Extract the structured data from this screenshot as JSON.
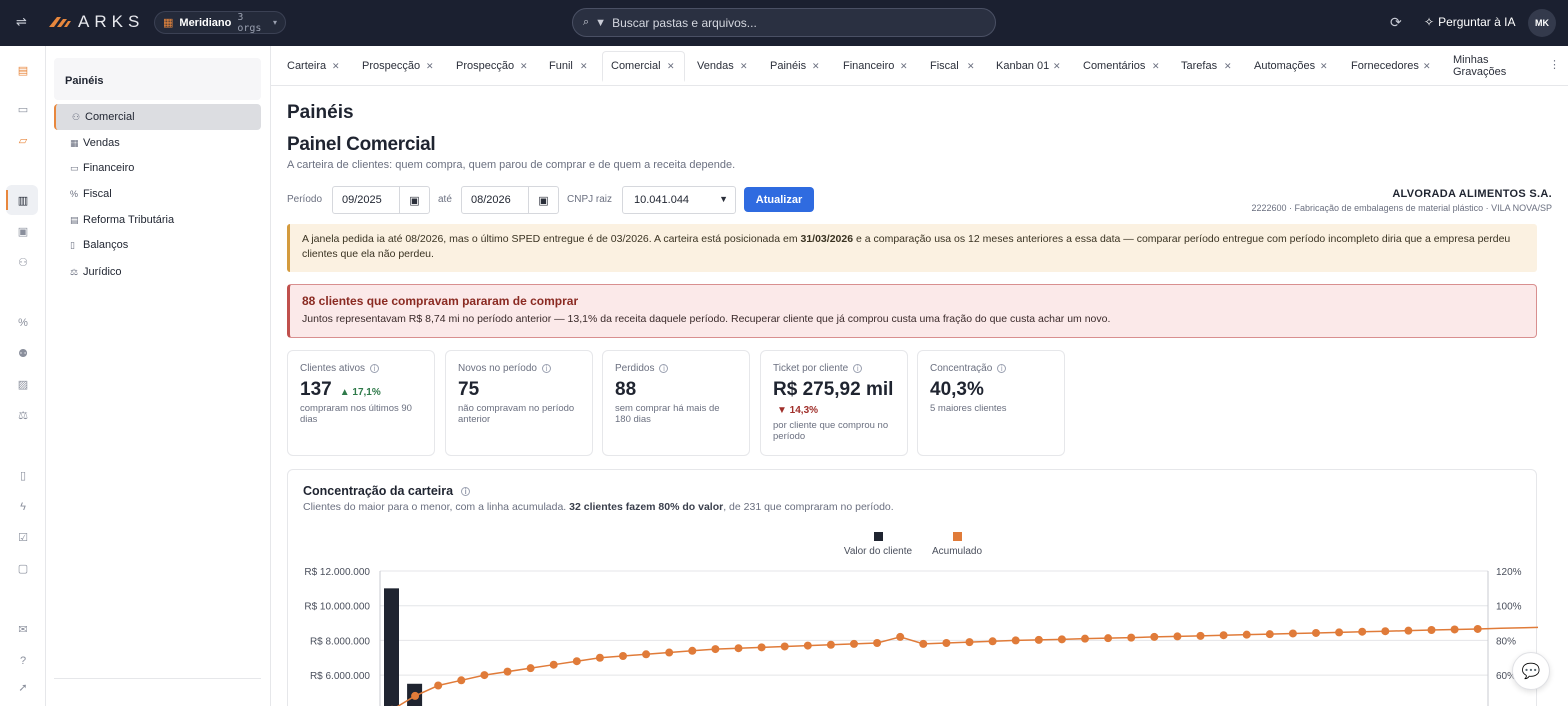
{
  "app": {
    "brand": "ARKS",
    "org_name": "Meridiano",
    "org_count": "3 orgs",
    "search_placeholder": "Buscar pastas e arquivos...",
    "ask_ai": "Perguntar à IA",
    "avatar": "MK"
  },
  "rail": {
    "icons": [
      "building-icon",
      "document-icon",
      "folder-icon",
      "bar-chart-icon",
      "card-icon",
      "users-icon",
      "percent-icon",
      "people-icon",
      "image-icon",
      "scale-icon",
      "book-icon",
      "bolt-icon",
      "check-icon",
      "chat-icon",
      "mail-icon",
      "help-icon",
      "rocket-icon"
    ],
    "active": "bar-chart-icon"
  },
  "sidepanel": {
    "title": "Painéis",
    "items": [
      {
        "label": "Comercial",
        "icon": "users-icon",
        "active": true
      },
      {
        "label": "Vendas",
        "icon": "grid-icon"
      },
      {
        "label": "Financeiro",
        "icon": "card-icon"
      },
      {
        "label": "Fiscal",
        "icon": "percent-icon"
      },
      {
        "label": "Reforma Tributária",
        "icon": "table-icon"
      },
      {
        "label": "Balanços",
        "icon": "file-icon"
      },
      {
        "label": "Jurídico",
        "icon": "scale-icon"
      }
    ]
  },
  "tabs": [
    {
      "label": "Carteira"
    },
    {
      "label": "Prospecção"
    },
    {
      "label": "Prospecção"
    },
    {
      "label": "Funil"
    },
    {
      "label": "Comercial",
      "active": true
    },
    {
      "label": "Vendas"
    },
    {
      "label": "Painéis"
    },
    {
      "label": "Financeiro"
    },
    {
      "label": "Fiscal"
    },
    {
      "label": "Kanban 01"
    },
    {
      "label": "Comentários"
    },
    {
      "label": "Tarefas"
    },
    {
      "label": "Automações"
    },
    {
      "label": "Fornecedores"
    },
    {
      "label": "Minhas Gravações"
    }
  ],
  "page": {
    "title": "Painéis",
    "panel_title": "Painel Comercial",
    "panel_subtitle": "A carteira de clientes: quem compra, quem parou de comprar e de quem a receita depende."
  },
  "filters": {
    "period_label": "Período",
    "from": "09/2025",
    "until_label": "até",
    "to": "08/2026",
    "cnpj_label": "CNPJ raiz",
    "cnpj_value": "10.041.044",
    "update_button": "Atualizar"
  },
  "company": {
    "name": "ALVORADA ALIMENTOS S.A.",
    "desc": "2222600 · Fabricação de embalagens de material plástico · VILA NOVA/SP"
  },
  "warning": {
    "text_before": "A janela pedida ia até 08/2026, mas o último SPED entregue é de 03/2026. A carteira está posicionada em ",
    "date_bold": "31/03/2026",
    "text_after": " e a comparação usa os 12 meses anteriores a essa data — comparar período entregue com período incompleto diria que a empresa perdeu clientes que ela não perdeu."
  },
  "danger": {
    "headline": "88 clientes que compravam pararam de comprar",
    "detail": "Juntos representavam R$ 8,74 mi no período anterior — 13,1% da receita daquele período. Recuperar cliente que já comprou custa uma fração do que custa achar um novo."
  },
  "kpis": [
    {
      "label": "Clientes ativos",
      "value": "137",
      "delta": "▲ 17,1%",
      "delta_dir": "up",
      "caption": "compraram nos últimos 90 dias"
    },
    {
      "label": "Novos no período",
      "value": "75",
      "delta": "",
      "caption": "não compravam no período anterior"
    },
    {
      "label": "Perdidos",
      "value": "88",
      "delta": "",
      "caption": "sem comprar há mais de 180 dias"
    },
    {
      "label": "Ticket por cliente",
      "value": "R$ 275,92 mil",
      "delta": "▼ 14,3%",
      "delta_dir": "down",
      "caption": "por cliente que comprou no período"
    },
    {
      "label": "Concentração",
      "value": "40,3%",
      "delta": "",
      "caption": "5 maiores clientes"
    }
  ],
  "chart_card": {
    "title": "Concentração da carteira",
    "sub_before": "Clientes do maior para o menor, com a linha acumulada. ",
    "sub_bold": "32 clientes fazem 80% do valor",
    "sub_after": ", de 231 que compraram no período."
  },
  "chart_data": {
    "type": "bar",
    "title": "",
    "legend": [
      "Valor do cliente",
      "Acumulado"
    ],
    "legend_position": "top-center",
    "colors": {
      "bars": "#1f2430",
      "line": "#e07b39"
    },
    "y_left_ticks": [
      "R$ 12.000.000",
      "R$ 10.000.000",
      "R$ 8.000.000",
      "R$ 6.000.000"
    ],
    "y_right_ticks": [
      "120%",
      "100%",
      "80%",
      "60%"
    ],
    "y_left_range": [
      4000000,
      12000000
    ],
    "y_right_range": [
      40,
      120
    ],
    "series": [
      {
        "name": "Valor do cliente",
        "type": "bar",
        "values": [
          11000000,
          5500000
        ]
      },
      {
        "name": "Acumulado",
        "type": "line",
        "values": [
          40,
          48,
          54,
          57,
          60,
          62,
          64,
          66,
          68,
          70,
          71,
          72,
          73,
          74,
          75,
          75.5,
          76,
          76.5,
          77,
          77.5,
          78,
          78.5,
          82,
          78,
          78.5,
          79,
          79.5,
          80,
          80.3,
          80.6,
          81,
          81.3,
          81.6,
          82,
          82.3,
          82.6,
          83,
          83.3,
          83.6,
          84,
          84.3,
          84.6,
          85,
          85.3,
          85.6,
          86,
          86.3,
          86.6,
          87,
          87.3,
          87.6
        ]
      }
    ]
  }
}
